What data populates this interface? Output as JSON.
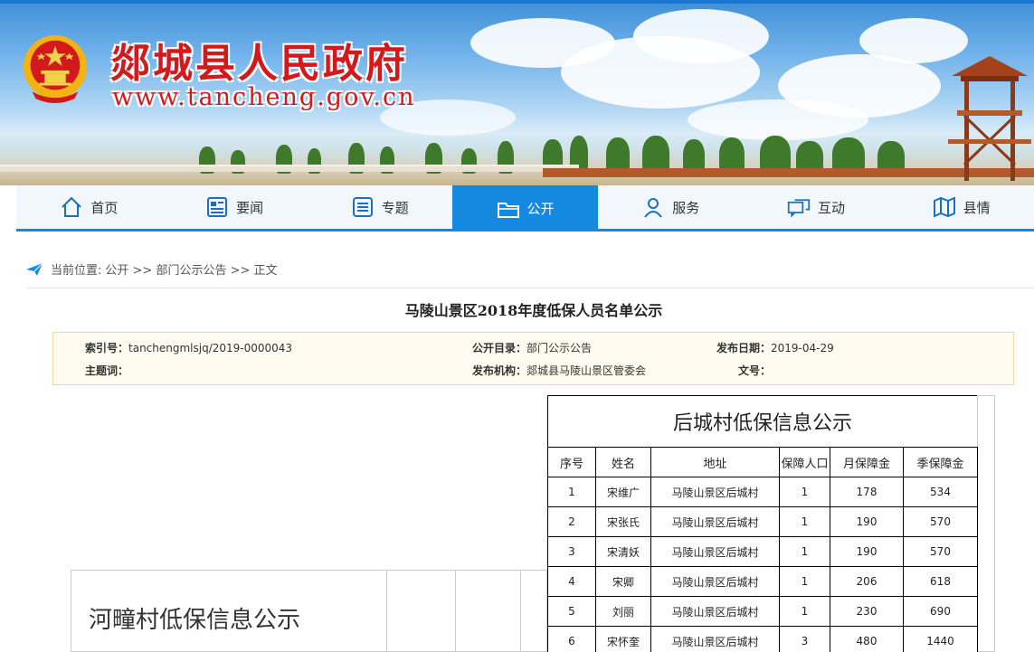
{
  "site": {
    "title": "郯城县人民政府",
    "url": "www.tancheng.gov.cn"
  },
  "nav": {
    "items": [
      {
        "label": "首页",
        "icon": "home-icon"
      },
      {
        "label": "要闻",
        "icon": "newspaper-icon"
      },
      {
        "label": "专题",
        "icon": "list-icon"
      },
      {
        "label": "公开",
        "icon": "folder-icon",
        "active": true
      },
      {
        "label": "服务",
        "icon": "user-icon"
      },
      {
        "label": "互动",
        "icon": "chat-icon"
      },
      {
        "label": "县情",
        "icon": "map-icon"
      }
    ]
  },
  "breadcrumb": {
    "prefix": "当前位置:",
    "path": "公开 >> 部门公示公告 >> 正文"
  },
  "article": {
    "title": "马陵山景区2018年度低保人员名单公示"
  },
  "meta": {
    "index_label": "索引号：",
    "index_value": "tanchengmlsjq/2019-0000043",
    "catalog_label": "公开目录：",
    "catalog_value": "部门公示公告",
    "date_label": "发布日期：",
    "date_value": "2019-04-29",
    "keyword_label": "主题词：",
    "keyword_value": "",
    "org_label": "发布机构：",
    "org_value": "郯城县马陵山景区管委会",
    "docno_label": "文号：",
    "docno_value": ""
  },
  "table_houcheng": {
    "title": "后城村低保信息公示",
    "headers": [
      "序号",
      "姓名",
      "地址",
      "保障人口",
      "月保障金",
      "季保障金"
    ],
    "rows": [
      [
        "1",
        "宋维广",
        "马陵山景区后城村",
        "1",
        "178",
        "534"
      ],
      [
        "2",
        "宋张氏",
        "马陵山景区后城村",
        "1",
        "190",
        "570"
      ],
      [
        "3",
        "宋清妖",
        "马陵山景区后城村",
        "1",
        "190",
        "570"
      ],
      [
        "4",
        "宋卿",
        "马陵山景区后城村",
        "1",
        "206",
        "618"
      ],
      [
        "5",
        "刘丽",
        "马陵山景区后城村",
        "1",
        "230",
        "690"
      ],
      [
        "6",
        "宋怀奎",
        "马陵山景区后城村",
        "3",
        "480",
        "1440"
      ]
    ]
  },
  "table_hetong": {
    "title": "河疃村低保信息公示"
  },
  "colors": {
    "nav_active": "#1589e0",
    "title_red": "#d3191c",
    "meta_bg": "#fffbf0"
  }
}
